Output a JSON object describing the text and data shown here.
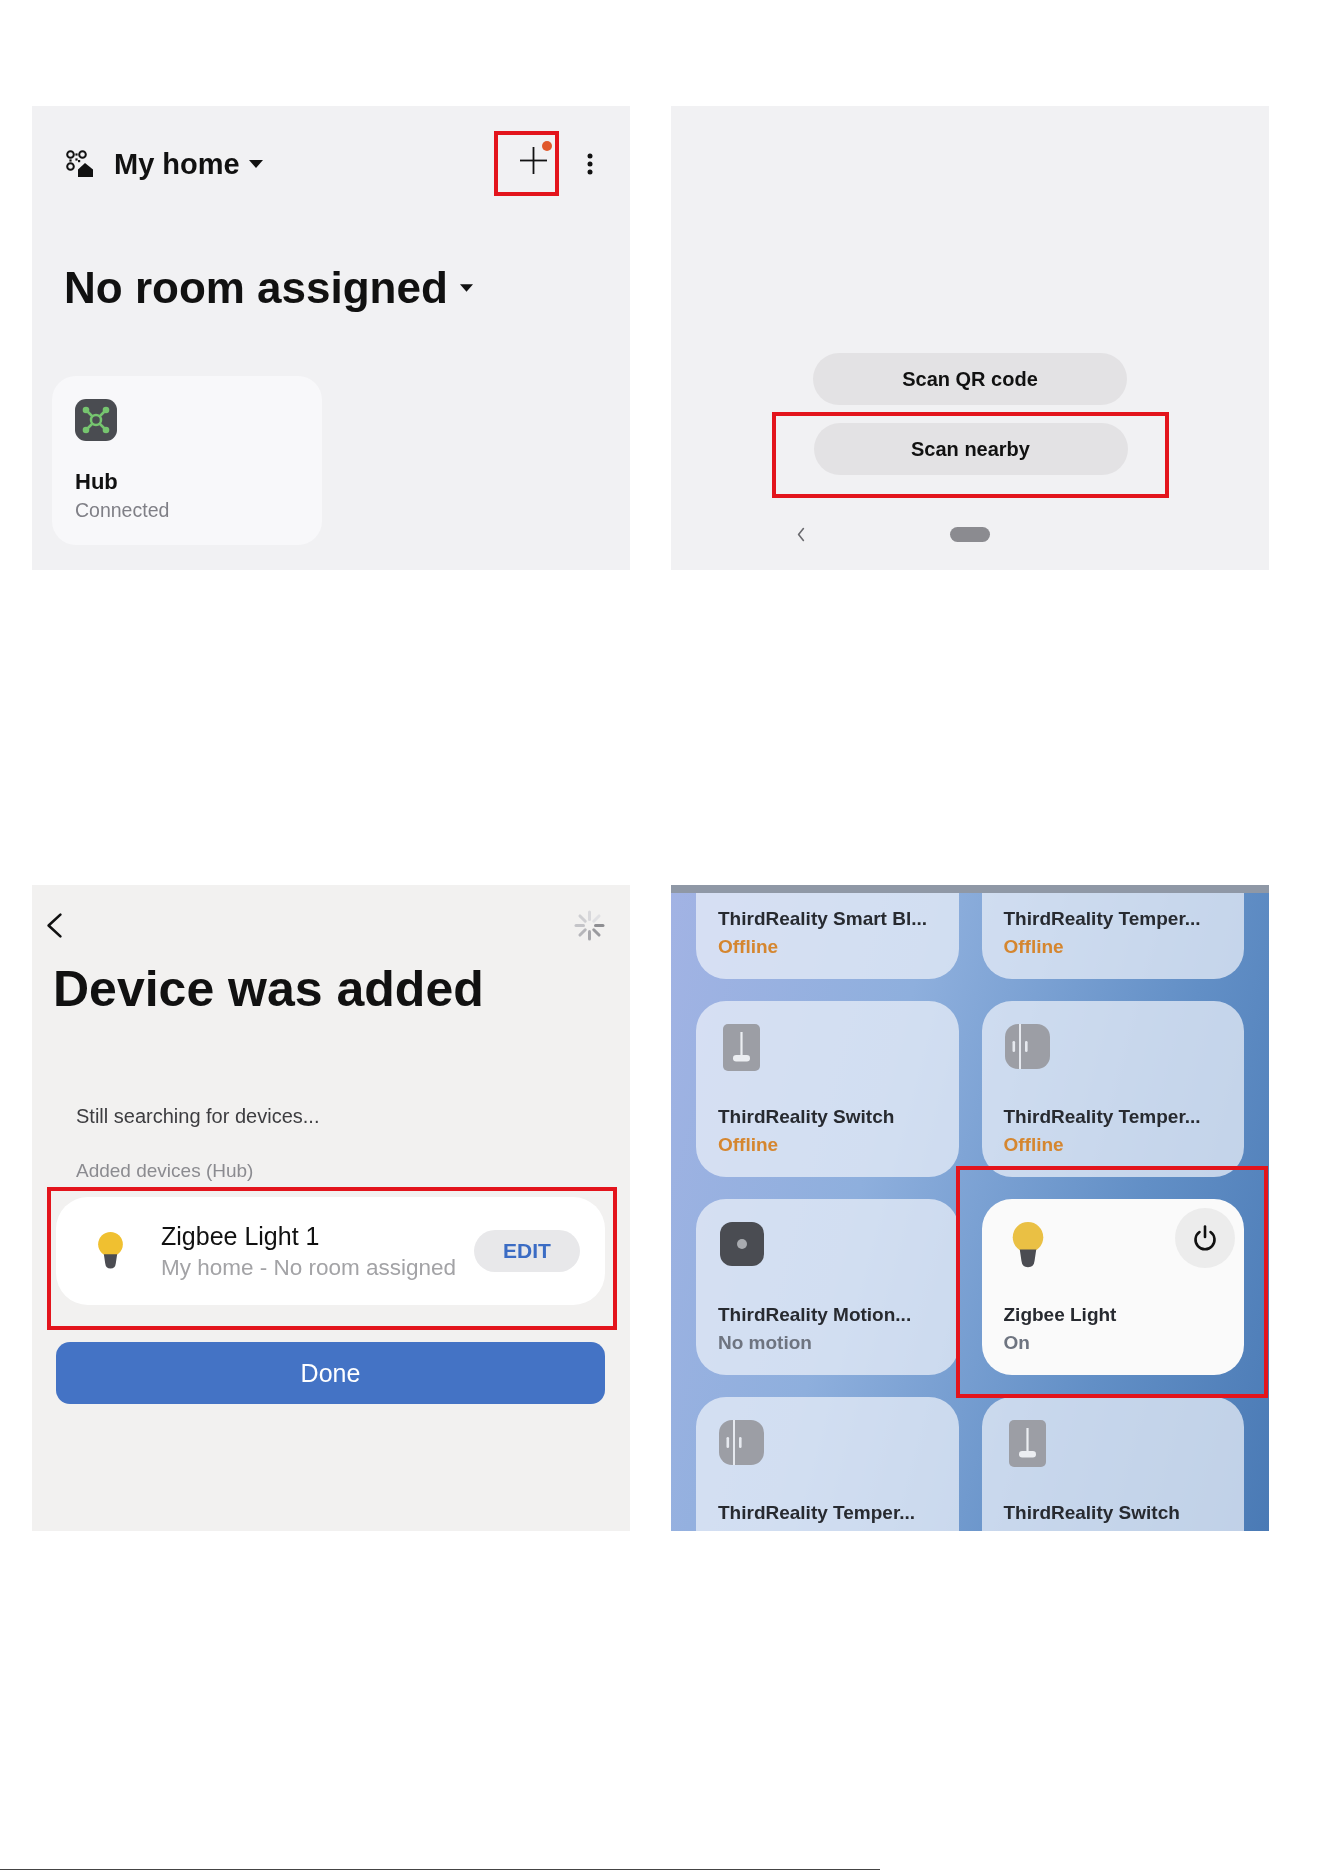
{
  "home_screen": {
    "home_name": "My home",
    "room": "No room assigned",
    "add_button": {
      "badge": true,
      "highlighted": true
    },
    "devices": [
      {
        "name": "Hub",
        "status": "Connected"
      }
    ]
  },
  "add_device_screen": {
    "buttons": [
      {
        "label": "Scan QR code",
        "highlighted": false
      },
      {
        "label": "Scan nearby",
        "highlighted": true
      }
    ]
  },
  "device_added_screen": {
    "title": "Device was added",
    "searching_text": "Still searching for devices...",
    "section_label": "Added devices (Hub)",
    "added_devices": [
      {
        "name": "Zigbee Light 1",
        "location": "My home - No room assigned",
        "edit_label": "EDIT",
        "highlighted": true
      }
    ],
    "done_label": "Done"
  },
  "devices_screen": {
    "devices": [
      {
        "name": "ThirdReality Smart Bl...",
        "status": "Offline",
        "offline": true,
        "on": false,
        "highlighted": false
      },
      {
        "name": "ThirdReality Temper...",
        "status": "Offline",
        "offline": true,
        "on": false,
        "highlighted": false
      },
      {
        "name": "ThirdReality Switch",
        "kind": "switch",
        "status": "Offline",
        "offline": true,
        "on": false,
        "highlighted": false
      },
      {
        "name": "ThirdReality Temper...",
        "kind": "contact",
        "status": "Offline",
        "offline": true,
        "on": false,
        "highlighted": false
      },
      {
        "name": "ThirdReality Motion...",
        "kind": "motion",
        "status": "No motion",
        "offline": false,
        "on": false,
        "highlighted": false
      },
      {
        "name": "Zigbee Light",
        "kind": "light",
        "status": "On",
        "offline": false,
        "on": true,
        "highlighted": true
      },
      {
        "name": "ThirdReality Temper...",
        "kind": "contact",
        "on": false,
        "highlighted": false
      },
      {
        "name": "ThirdReality Switch",
        "kind": "switch",
        "on": false,
        "highlighted": false
      }
    ]
  }
}
